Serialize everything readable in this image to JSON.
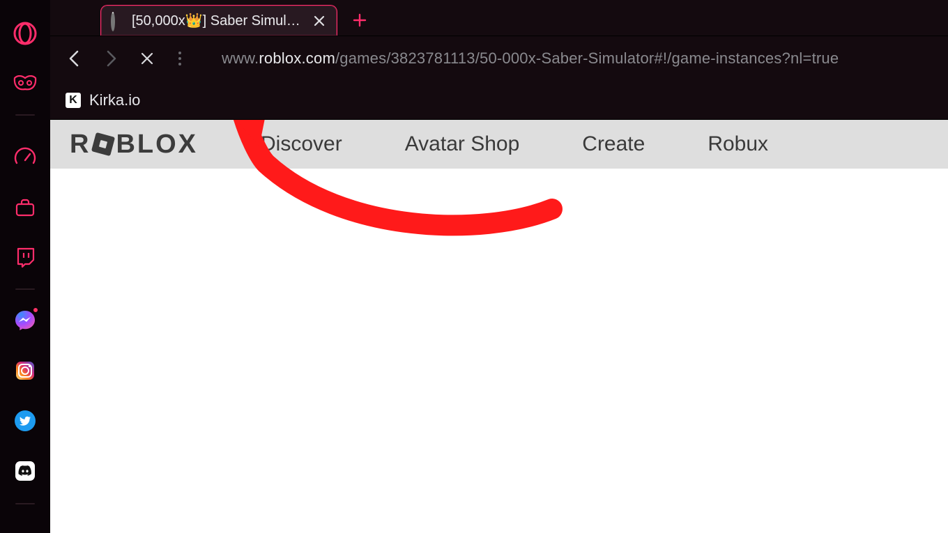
{
  "browser": {
    "tab": {
      "title_prefix": "[50,000x",
      "crown": "👑",
      "title_suffix": "] Saber Simulator",
      "loading": true
    },
    "address": {
      "scheme": "",
      "sub": "www.",
      "host": "roblox.com",
      "path": "/games/3823781113/50-000x-Saber-Simulator#!/game-instances?nl=true"
    },
    "bookmarks": [
      {
        "icon_letter": "K",
        "label": "Kirka.io"
      }
    ]
  },
  "sidebar": {
    "items": [
      {
        "name": "opera-logo-icon"
      },
      {
        "name": "gx-mask-icon"
      },
      {
        "name": "gx-corner-icon"
      },
      {
        "name": "briefcase-icon"
      },
      {
        "name": "twitch-icon"
      },
      {
        "name": "messenger-icon",
        "notif": true
      },
      {
        "name": "instagram-icon"
      },
      {
        "name": "twitter-icon"
      },
      {
        "name": "discord-icon"
      }
    ],
    "separators_after": [
      1,
      4
    ]
  },
  "roblox": {
    "logo_text_before": "R",
    "logo_text_after": "BLOX",
    "nav": [
      "Discover",
      "Avatar Shop",
      "Create",
      "Robux"
    ]
  },
  "annotation": {
    "color": "#ff1a1a",
    "points_to": "refresh / address area"
  }
}
